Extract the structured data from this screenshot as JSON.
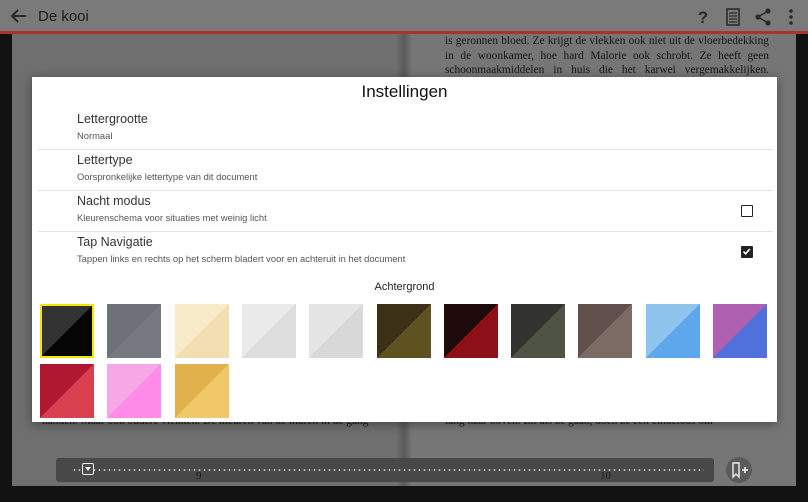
{
  "toolbar": {
    "title": "De kooi",
    "icons": [
      "arrow-back-icon",
      "help-icon",
      "table-of-contents-icon",
      "share-icon",
      "overflow-menu-icon"
    ]
  },
  "book": {
    "right_top_text": "is geronnen bloed. Ze krijgt de vlekken ook niet uit de vloerbedekking in de woonkamer, hoe hard Malorie ook schrobt. Ze heeft geen schoonmaakmiddelen in huis die het karwei vergemakkelijken. Malorie",
    "left_bottom_text": "handen. Maar ook oudere vlekken. De kleuren van de muren in de gang",
    "right_bottom_text": "lang naar boven. Zit als ze gaan, doen ze een eindeloos om",
    "page_left": "9",
    "page_right": "10"
  },
  "dialog": {
    "title": "Instellingen",
    "settings": [
      {
        "title": "Lettergrootte",
        "subtitle": "Normaal"
      },
      {
        "title": "Lettertype",
        "subtitle": "Oorspronkelijke lettertype van dit document"
      },
      {
        "title": "Nacht modus",
        "subtitle": "Kleurenschema voor situaties met weinig licht",
        "checked": false
      },
      {
        "title": "Tap Navigatie",
        "subtitle": "Tappen links en rechts op het scherm bladert voor en achteruit in het document",
        "checked": true
      }
    ],
    "background_label": "Achtergrond",
    "selected_background": 0,
    "backgrounds": [
      {
        "c1": "#333333",
        "c2": "#050505"
      },
      {
        "c1": "#6f7178",
        "c2": "#777980"
      },
      {
        "c1": "#f8ecc8",
        "c2": "#f1dfb1"
      },
      {
        "c1": "#eaeaea",
        "c2": "#dddddd"
      },
      {
        "c1": "#e4e4e4",
        "c2": "#d8d8d8"
      },
      {
        "c1": "#3c3116",
        "c2": "#5e5220"
      },
      {
        "c1": "#1f0a0c",
        "c2": "#8e1018"
      },
      {
        "c1": "#32332e",
        "c2": "#4f5346"
      },
      {
        "c1": "#61504c",
        "c2": "#7c6a64"
      },
      {
        "c1": "#8ec4ee",
        "c2": "#5ea7ec"
      },
      {
        "c1": "#b060b0",
        "c2": "#5070dc"
      },
      {
        "c1": "#b01830",
        "c2": "#d84050"
      },
      {
        "c1": "#f6a8e6",
        "c2": "#ff8ce8"
      },
      {
        "c1": "#e0b24c",
        "c2": "#f0c86a"
      }
    ]
  }
}
